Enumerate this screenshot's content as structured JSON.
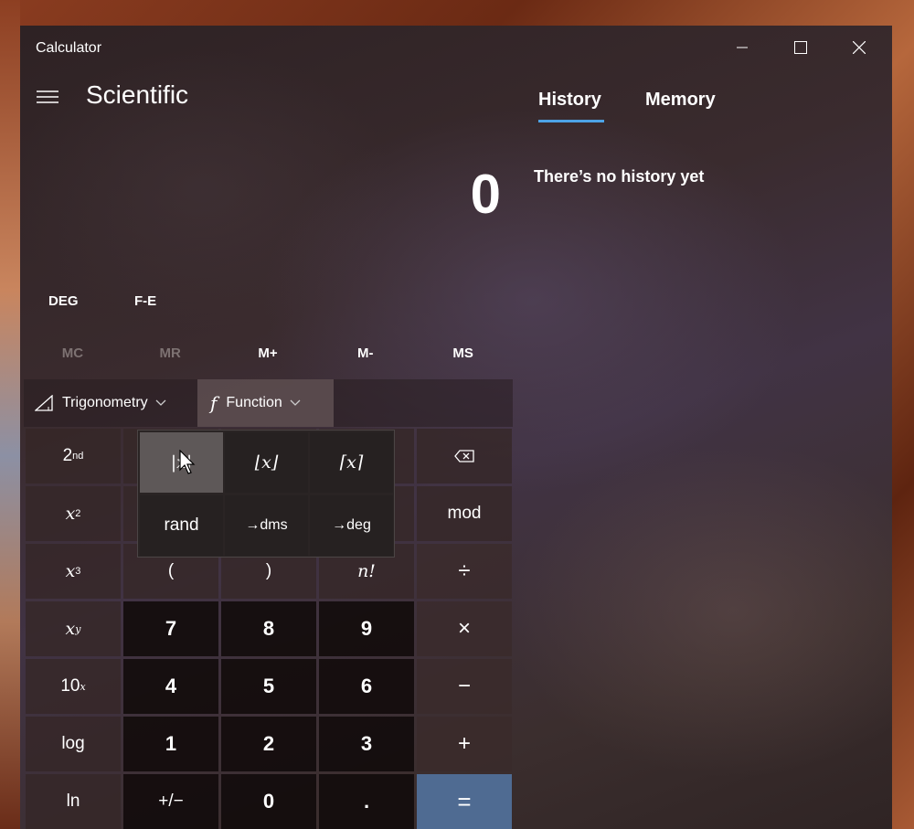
{
  "window": {
    "title": "Calculator"
  },
  "header": {
    "mode_title": "Scientific"
  },
  "display": {
    "value": "0"
  },
  "modes": {
    "angle": "DEG",
    "notation": "F-E"
  },
  "memory_buttons": [
    "MC",
    "MR",
    "M+",
    "M-",
    "MS"
  ],
  "function_bar": {
    "trigonometry": "Trigonometry",
    "function": "Function"
  },
  "keys": {
    "row1": [
      "2",
      "nd",
      "",
      "",
      "",
      "⌫"
    ],
    "x2_base": "x",
    "x2_exp": "2",
    "x3_base": "x",
    "x3_exp": "3",
    "xy_base": "x",
    "xy_exp": "y",
    "tenx_base": "10",
    "tenx_exp": "x",
    "log": "log",
    "ln": "ln",
    "mod": "mod",
    "paren_open": "(",
    "paren_close": ")",
    "factorial": "n!",
    "divide": "÷",
    "multiply": "×",
    "minus": "−",
    "plus": "+",
    "equals": "=",
    "seven": "7",
    "eight": "8",
    "nine": "9",
    "four": "4",
    "five": "5",
    "six": "6",
    "one": "1",
    "two": "2",
    "three": "3",
    "negate": "+/−",
    "zero": "0",
    "decimal": "."
  },
  "function_popup": {
    "abs": "|x|",
    "floor": "⌊x⌋",
    "ceil": "⌈x⌉",
    "rand": "rand",
    "dms": "→dms",
    "deg": "→deg"
  },
  "side_panel": {
    "tabs": [
      "History",
      "Memory"
    ],
    "active_tab": "History",
    "empty_message": "There’s no history yet"
  },
  "colors": {
    "accent": "#4da3e6",
    "equals_key": "#4f6b92"
  }
}
